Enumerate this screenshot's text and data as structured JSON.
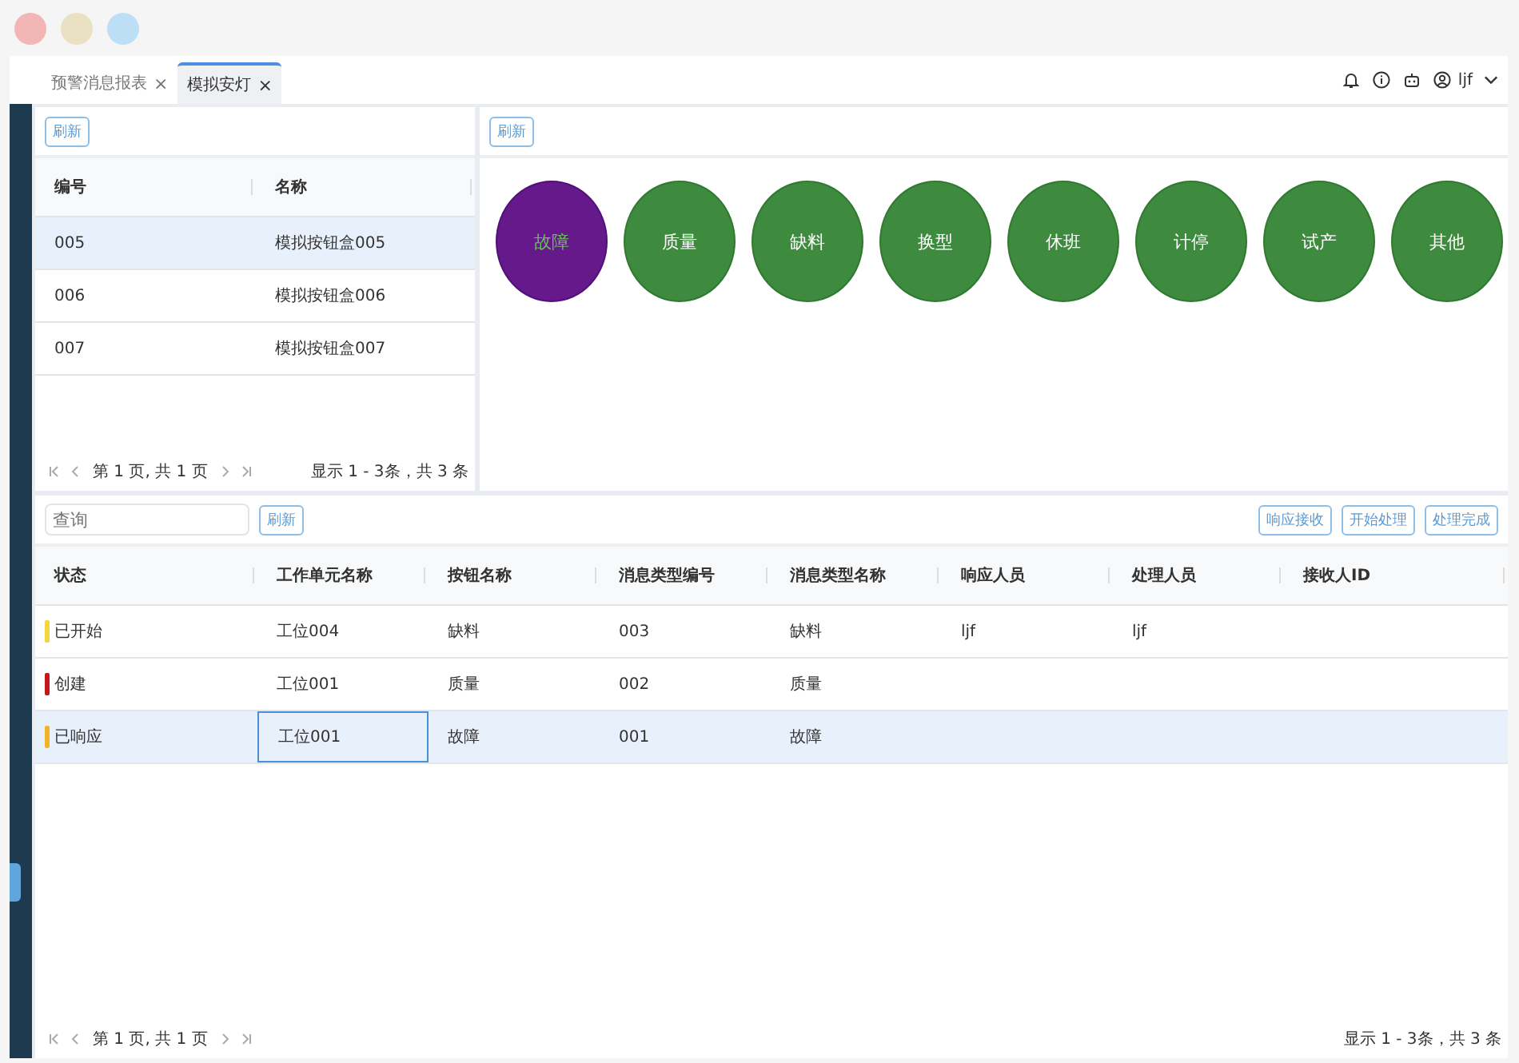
{
  "tabs": [
    {
      "label": "预警消息报表",
      "close": "×",
      "selected": false
    },
    {
      "label": "模拟安灯",
      "close": "×",
      "selected": true
    }
  ],
  "header": {
    "user": "ljf"
  },
  "device_panel": {
    "refresh": "刷新",
    "columns": [
      "编号",
      "名称"
    ],
    "rows": [
      {
        "cells": [
          "005",
          "模拟按钮盒005"
        ],
        "selected": true
      },
      {
        "cells": [
          "006",
          "模拟按钮盒006"
        ],
        "selected": false
      },
      {
        "cells": [
          "007",
          "模拟按钮盒007"
        ],
        "selected": false
      }
    ],
    "pager": {
      "page": "第 1 页, 共 1 页",
      "summary": "显示 1 - 3条，共 3 条"
    }
  },
  "alarm_panel": {
    "refresh": "刷新",
    "buttons": [
      {
        "label": "故障",
        "selected": true
      },
      {
        "label": "质量",
        "selected": false
      },
      {
        "label": "缺料",
        "selected": false
      },
      {
        "label": "换型",
        "selected": false
      },
      {
        "label": "休班",
        "selected": false
      },
      {
        "label": "计停",
        "selected": false
      },
      {
        "label": "试产",
        "selected": false
      },
      {
        "label": "其他",
        "selected": false
      }
    ]
  },
  "message_panel": {
    "search": {
      "placeholder": "查询"
    },
    "refresh": "刷新",
    "actions": [
      "响应接收",
      "开始处理",
      "处理完成"
    ],
    "columns": [
      "状态",
      "工作单元名称",
      "按钮名称",
      "消息类型编号",
      "消息类型名称",
      "响应人员",
      "处理人员",
      "接收人ID"
    ],
    "rows": [
      {
        "color": "#f5d442",
        "cells": [
          "已开始",
          "工位004",
          "缺料",
          "003",
          "缺料",
          "ljf",
          "ljf",
          ""
        ],
        "selected": false
      },
      {
        "color": "#c4161c",
        "cells": [
          "创建",
          "工位001",
          "质量",
          "002",
          "质量",
          "",
          "",
          ""
        ],
        "selected": false
      },
      {
        "color": "#f0b429",
        "cells": [
          "已响应",
          "工位001",
          "故障",
          "001",
          "故障",
          "",
          "",
          ""
        ],
        "selected": true
      }
    ],
    "pager": {
      "page": "第 1 页, 共 1 页",
      "summary": "显示 1 - 3条，共 3 条"
    }
  }
}
